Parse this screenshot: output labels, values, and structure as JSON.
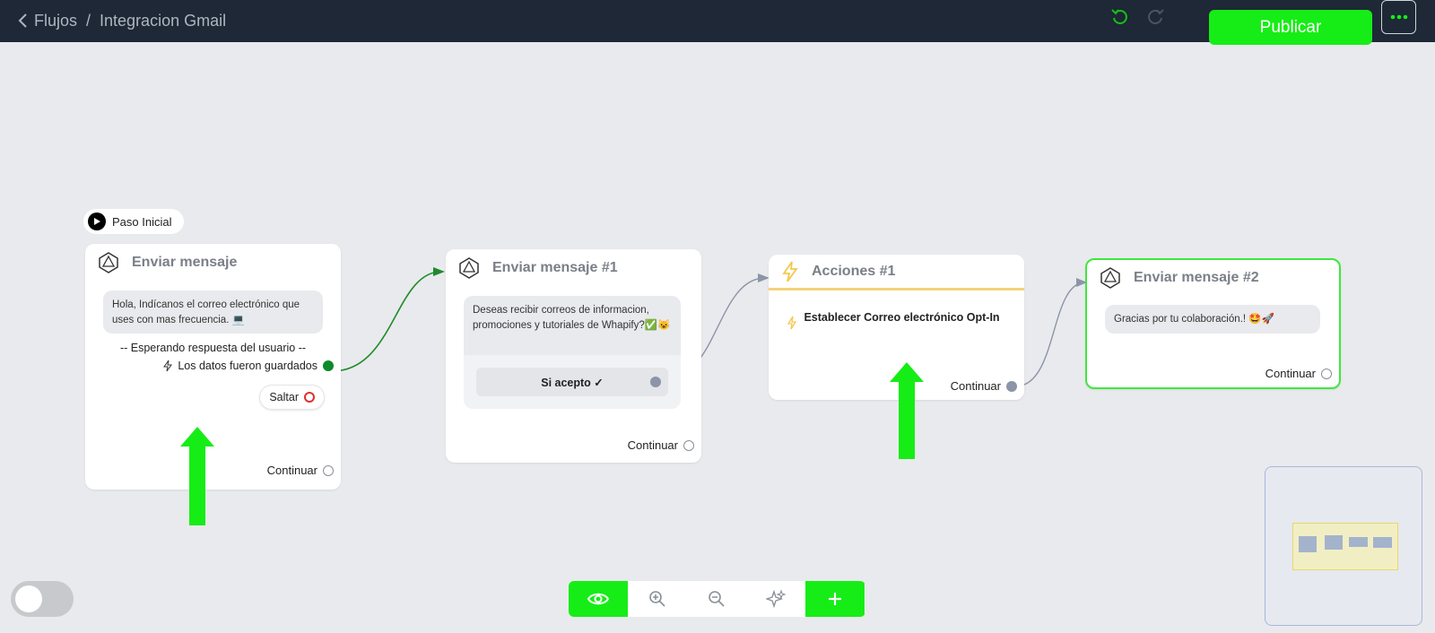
{
  "header": {
    "breadcrumb_root": "Flujos",
    "breadcrumb_sep": "/",
    "breadcrumb_current": "Integracion Gmail",
    "publish_label": "Publicar"
  },
  "start": {
    "label": "Paso Inicial"
  },
  "nodes": [
    {
      "title": "Enviar mensaje",
      "message": "Hola, Indícanos el correo electrónico que uses con mas frecuencia. 💻",
      "waiting": "-- Esperando respuesta del usuario --",
      "saved": "Los datos fueron guardados",
      "skip": "Saltar",
      "continue": "Continuar"
    },
    {
      "title": "Enviar mensaje #1",
      "message": "Deseas recibir correos de informacion, promociones y tutoriales de Whapify?✅😺",
      "button": "Si acepto ✓",
      "continue": "Continuar"
    },
    {
      "title": "Acciones #1",
      "action": "Establecer Correo electrónico Opt-In",
      "continue": "Continuar"
    },
    {
      "title": "Enviar mensaje #2",
      "message": "Gracias por tu colaboración.! 🤩🚀",
      "continue": "Continuar"
    }
  ],
  "colors": {
    "topbar": "#1e2836",
    "accent_green": "#16ed16",
    "canvas": "#e9eaed",
    "action_yellow": "#f2c94c"
  }
}
